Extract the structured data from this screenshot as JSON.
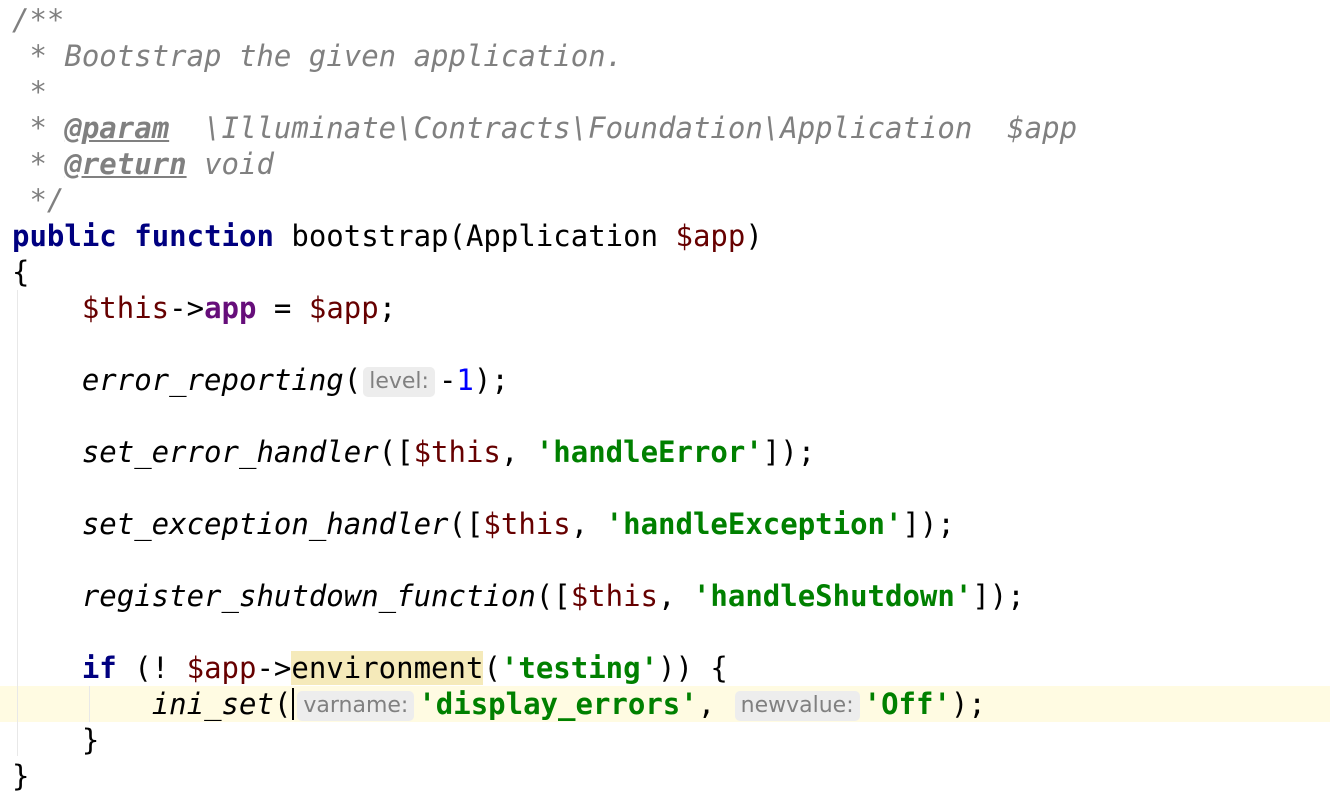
{
  "doc_comment": {
    "open": "/**",
    "summary": " * Bootstrap the given application.",
    "blank": " *",
    "star": " * ",
    "param_tag": "@param",
    "param_text": "  \\Illuminate\\Contracts\\Foundation\\Application  $app",
    "return_tag": "@return",
    "return_text": " void",
    "close": " */"
  },
  "signature": {
    "kw_public": "public",
    "kw_function": "function",
    "name_and_type": " bootstrap(Application ",
    "param_var": "$app",
    "close": ")"
  },
  "braces": {
    "open": "{",
    "close": "}",
    "inner_close": "}"
  },
  "lines": {
    "assign": {
      "this": "$this",
      "arrow": "->",
      "prop": "app",
      "eq": " = ",
      "val": "$app",
      "end": ";"
    },
    "error_reporting": {
      "fn": "error_reporting",
      "open": "(",
      "hint": "level:",
      "minus": "-",
      "num": "1",
      "end": ");"
    },
    "set_error_handler": {
      "fn": "set_error_handler",
      "open": "([",
      "this": "$this",
      "comma": ", ",
      "str": "'handleError'",
      "end": "]);"
    },
    "set_exception_handler": {
      "fn": "set_exception_handler",
      "open": "([",
      "this": "$this",
      "comma": ", ",
      "str": "'handleException'",
      "end": "]);"
    },
    "register_shutdown": {
      "fn": "register_shutdown_function",
      "open": "([",
      "this": "$this",
      "comma": ", ",
      "str": "'handleShutdown'",
      "end": "]);"
    },
    "if_line": {
      "kw_if": "if",
      "not": " (! ",
      "var": "$app",
      "arrow": "->",
      "method": "environment",
      "open": "(",
      "str": "'testing'",
      "end": ")) {"
    },
    "ini_set": {
      "fn": "ini_set",
      "open": "(",
      "hint1": "varname:",
      "str1": "'display_errors'",
      "comma": ", ",
      "hint2": "newvalue:",
      "str2": "'Off'",
      "end": ");"
    }
  },
  "colors": {
    "keyword": "#000080",
    "variable": "#660000",
    "field": "#660e7a",
    "string": "#008000",
    "number": "#0000ff",
    "comment": "#808080",
    "current_line": "#fffbe2",
    "usage_highlight": "#f5eaba"
  }
}
